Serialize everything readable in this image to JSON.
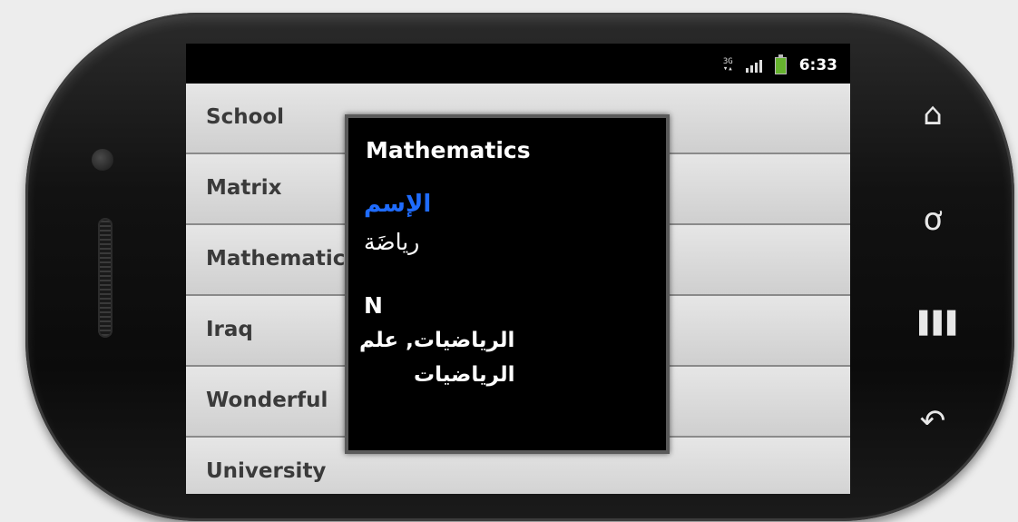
{
  "status_bar": {
    "time": "6:33",
    "data_icon": "sim-data-icon",
    "signal_icon": "signal-icon",
    "battery_icon": "battery-charging-icon"
  },
  "list": {
    "items": [
      {
        "label": "School"
      },
      {
        "label": "Matrix"
      },
      {
        "label": "Mathematics"
      },
      {
        "label": "Iraq"
      },
      {
        "label": "Wonderful"
      },
      {
        "label": "University"
      }
    ]
  },
  "dialog": {
    "title": "Mathematics",
    "headword": "الإسم",
    "translation": "رياضَة",
    "part_of_speech": "N",
    "definition_line1": "الرياضيات, علم",
    "definition_line2": "الرياضيات"
  },
  "nav_buttons": [
    {
      "icon": "home-icon",
      "glyph": "⌂"
    },
    {
      "icon": "search-icon",
      "glyph": "ơ"
    },
    {
      "icon": "menu-icon",
      "glyph": "❚"
    },
    {
      "icon": "back-icon",
      "glyph": "↶"
    }
  ],
  "colors": {
    "headword": "#1f6cff",
    "battery": "#66b32e"
  }
}
